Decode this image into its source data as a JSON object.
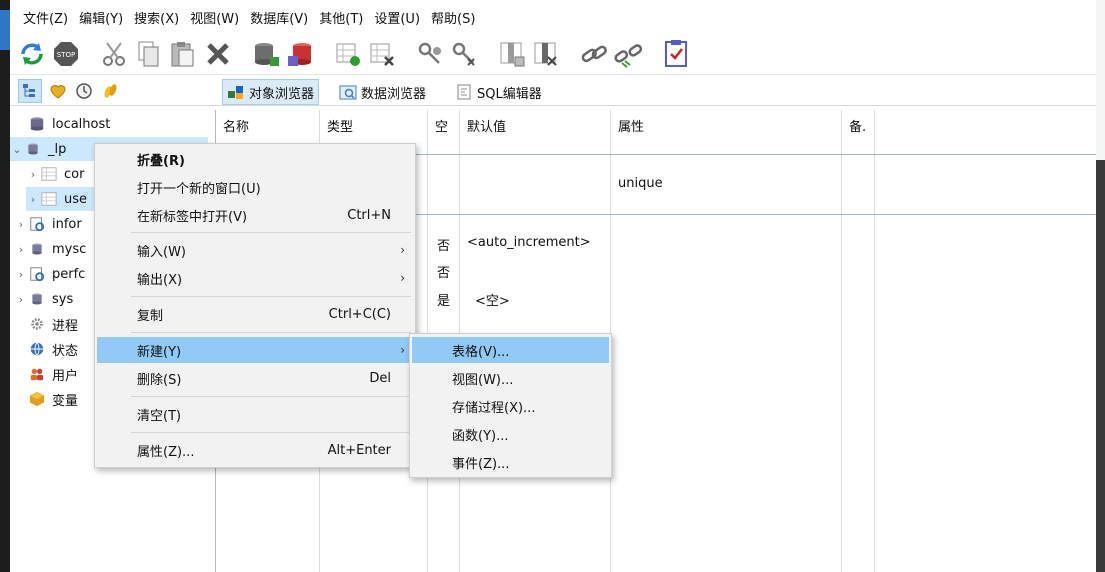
{
  "menubar": [
    "文件(Z)",
    "编辑(Y)",
    "搜索(X)",
    "视图(W)",
    "数据库(V)",
    "其他(T)",
    "设置(U)",
    "帮助(S)"
  ],
  "toolbar": {
    "icons": [
      "refresh-icon",
      "stop-icon",
      "cut-icon",
      "copy-icon",
      "paste-icon",
      "delete-icon",
      "database-add-icon",
      "database-delete-icon",
      "table-add-icon",
      "table-delete-icon",
      "key-add-icon",
      "key-delete-icon",
      "column-add-icon",
      "column-delete-icon",
      "link-icon",
      "unlink-icon",
      "checklist-icon"
    ]
  },
  "toolbar2": {
    "icons": [
      "tree-view-icon",
      "favorites-icon",
      "history-icon",
      "snippets-icon"
    ],
    "tabs": [
      "对象浏览器",
      "数据浏览器",
      "SQL编辑器"
    ]
  },
  "tree": {
    "items": [
      {
        "label": "localhost"
      },
      {
        "label": "_lp"
      },
      {
        "label": "cor"
      },
      {
        "label": "use"
      },
      {
        "label": "infor"
      },
      {
        "label": "mysc"
      },
      {
        "label": "perfc"
      },
      {
        "label": "sys"
      },
      {
        "label": "进程"
      },
      {
        "label": "状态"
      },
      {
        "label": "用户"
      },
      {
        "label": "变量"
      }
    ]
  },
  "grid": {
    "headers": [
      "名称",
      "类型",
      "空",
      "默认值",
      "属性",
      "备."
    ],
    "unique": "unique",
    "null_values": [
      "否",
      "否",
      "是"
    ],
    "default_values": [
      "<auto_increment>",
      "<空>"
    ]
  },
  "context_menu": {
    "items": [
      {
        "label": "折叠(R)",
        "shortcut": ""
      },
      {
        "label": "打开一个新的窗口(U)",
        "shortcut": ""
      },
      {
        "label": "在新标签中打开(V)",
        "shortcut": "Ctrl+N"
      },
      {
        "label": "输入(W)",
        "shortcut": ""
      },
      {
        "label": "输出(X)",
        "shortcut": ""
      },
      {
        "label": "复制",
        "shortcut": "Ctrl+C(C)"
      },
      {
        "label": "新建(Y)",
        "shortcut": ""
      },
      {
        "label": "删除(S)",
        "shortcut": "Del"
      },
      {
        "label": "清空(T)",
        "shortcut": ""
      },
      {
        "label": "属性(Z)...",
        "shortcut": "Alt+Enter"
      }
    ],
    "submenu_arrow": "›"
  },
  "submenu": {
    "items": [
      "表格(V)...",
      "视图(W)...",
      "存储过程(X)...",
      "函数(Y)...",
      "事件(Z)..."
    ]
  },
  "colors": {
    "highlight": "#91c9f7",
    "selection": "#cce8ff",
    "accent": "#2e76c6"
  }
}
